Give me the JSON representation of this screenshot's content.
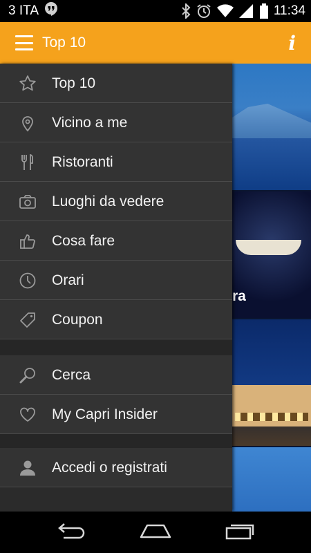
{
  "status_bar": {
    "carrier": "3 ITA",
    "time": "11:34"
  },
  "action_bar": {
    "title": "Top 10",
    "info_label": "i"
  },
  "background_content": {
    "visible_label": "ra"
  },
  "drawer": {
    "group1": [
      {
        "label": "Top 10",
        "icon": "star-icon"
      },
      {
        "label": "Vicino a me",
        "icon": "location-pin-icon"
      },
      {
        "label": "Ristoranti",
        "icon": "fork-knife-icon"
      },
      {
        "label": "Luoghi da vedere",
        "icon": "camera-icon"
      },
      {
        "label": "Cosa fare",
        "icon": "thumbs-up-icon"
      },
      {
        "label": "Orari",
        "icon": "clock-icon"
      },
      {
        "label": "Coupon",
        "icon": "tag-icon"
      }
    ],
    "group2": [
      {
        "label": "Cerca",
        "icon": "search-icon"
      },
      {
        "label": "My Capri Insider",
        "icon": "heart-icon"
      }
    ],
    "group3": [
      {
        "label": "Accedi o registrati",
        "icon": "user-icon"
      }
    ]
  },
  "colors": {
    "accent": "#f5a21c",
    "drawer_item": "#333333",
    "drawer_bg": "#2b2b2b"
  }
}
